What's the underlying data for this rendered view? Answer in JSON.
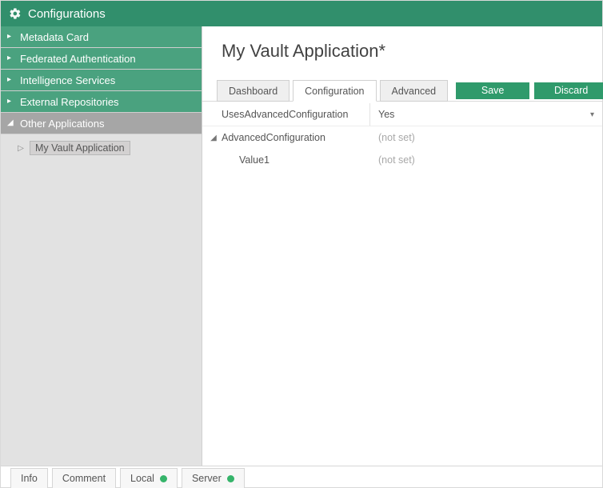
{
  "header": {
    "title": "Configurations"
  },
  "sidebar": {
    "items": [
      {
        "label": "Metadata Card"
      },
      {
        "label": "Federated Authentication"
      },
      {
        "label": "Intelligence Services"
      },
      {
        "label": "External Repositories"
      },
      {
        "label": "Other Applications"
      }
    ],
    "tree": {
      "selected_label": "My Vault Application"
    }
  },
  "main": {
    "title": "My Vault Application*",
    "tabs": [
      {
        "label": "Dashboard"
      },
      {
        "label": "Configuration"
      },
      {
        "label": "Advanced"
      }
    ],
    "active_tab_index": 1,
    "buttons": {
      "save": "Save",
      "discard": "Discard"
    },
    "grid": [
      {
        "key": "UsesAdvancedConfiguration",
        "value": "Yes",
        "type": "dropdown",
        "expandable": false,
        "indent": 1
      },
      {
        "key": "AdvancedConfiguration",
        "value": "(not set)",
        "type": "notset",
        "expandable": true,
        "expanded": true,
        "indent": 1
      },
      {
        "key": "Value1",
        "value": "(not set)",
        "type": "notset",
        "expandable": false,
        "indent": 2
      }
    ]
  },
  "footer": {
    "tabs": [
      {
        "label": "Info",
        "dot": false
      },
      {
        "label": "Comment",
        "dot": false
      },
      {
        "label": "Local",
        "dot": true
      },
      {
        "label": "Server",
        "dot": true
      }
    ]
  },
  "colors": {
    "brand": "#318f6c",
    "accent": "#4aa27f",
    "button": "#2f9a6b",
    "status_dot": "#35b46a"
  }
}
